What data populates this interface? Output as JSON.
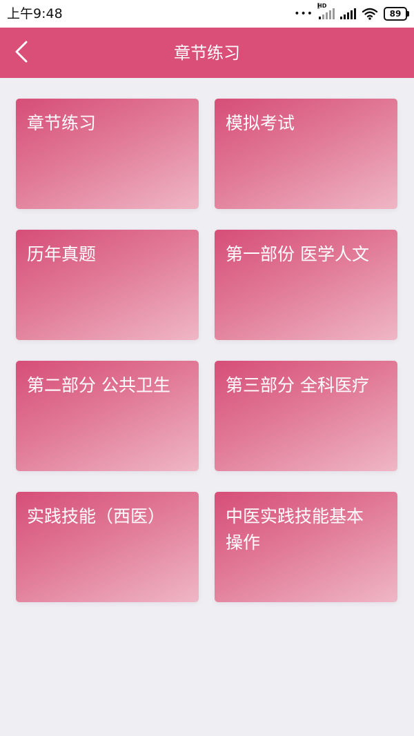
{
  "status_bar": {
    "time": "上午9:48",
    "dots": "•••",
    "network_label": "HD",
    "battery": "89",
    "icons": [
      "cell-signal-icon",
      "cell-signal-icon",
      "wifi-icon",
      "battery-icon"
    ]
  },
  "header": {
    "title": "章节练习",
    "back_icon": "chevron-left-icon",
    "background": "#d94f77"
  },
  "grid": {
    "items": [
      {
        "label": "章节练习"
      },
      {
        "label": "模拟考试"
      },
      {
        "label": "历年真题"
      },
      {
        "label": "第一部份 医学人文"
      },
      {
        "label": "第二部分 公共卫生"
      },
      {
        "label": "第三部分 全科医疗"
      },
      {
        "label": "实践技能（西医）"
      },
      {
        "label": "中医实践技能基本\n操作"
      }
    ],
    "card_gradient": [
      "#d64e78",
      "#e07694",
      "#efb7c6"
    ]
  }
}
